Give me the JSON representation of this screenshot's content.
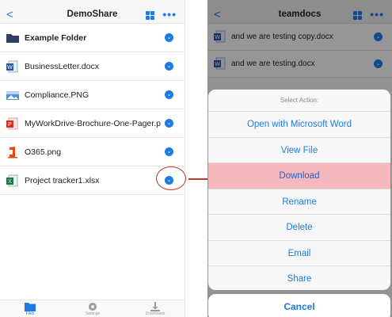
{
  "left": {
    "nav": {
      "back": "<",
      "title": "DemoShare",
      "more": "•••"
    },
    "files": [
      {
        "name": "Example Folder",
        "bold": true,
        "icon": "folder-icon"
      },
      {
        "name": "BusinessLetter.docx",
        "bold": false,
        "icon": "word-doc-icon"
      },
      {
        "name": "Compliance.PNG",
        "bold": false,
        "icon": "image-icon"
      },
      {
        "name": "MyWorkDrive-Brochure-One-Pager.p...",
        "bold": false,
        "icon": "pdf-icon"
      },
      {
        "name": "O365.png",
        "bold": false,
        "icon": "office-icon"
      },
      {
        "name": "Project tracker1.xlsx",
        "bold": false,
        "icon": "excel-icon"
      }
    ],
    "chevron": "⌄",
    "tabs": {
      "files": "Files",
      "settings": "Settings",
      "downloads": "Downloads"
    }
  },
  "right": {
    "nav": {
      "back": "<",
      "title": "teamdocs",
      "more": "•••"
    },
    "files": [
      {
        "name": "and we are testing copy.docx",
        "icon": "word-doc-icon"
      },
      {
        "name": "and we are testing.docx",
        "icon": "word-doc-icon"
      }
    ],
    "sheet": {
      "title": "Select Action:",
      "actions": [
        "Open with Microsoft Word",
        "View File",
        "Download",
        "Rename",
        "Delete",
        "Email",
        "Share"
      ],
      "cancel": "Cancel"
    }
  },
  "colors": {
    "accent": "#1e7be0",
    "highlight": "#f5b9bd",
    "annotation": "#c0392b"
  }
}
